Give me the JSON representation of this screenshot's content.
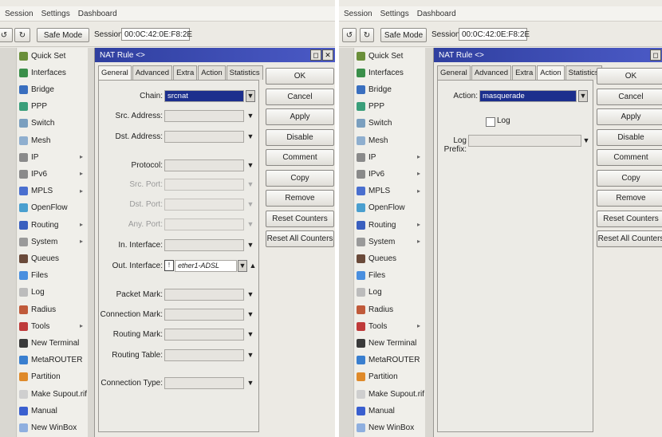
{
  "menubar": {
    "items": [
      "Session",
      "Settings",
      "Dashboard"
    ]
  },
  "toolbar": {
    "safe_mode": "Safe Mode",
    "session_label": "Session:",
    "session_value": "00:0C:42:0E:F8:2E"
  },
  "sidebar": {
    "items": [
      {
        "label": "Quick Set",
        "icon": "quick-set-icon",
        "color": "#6a8f3a",
        "submenu": false
      },
      {
        "label": "Interfaces",
        "icon": "interfaces-icon",
        "color": "#3a8f4a",
        "submenu": false
      },
      {
        "label": "Bridge",
        "icon": "bridge-icon",
        "color": "#3a6fbf",
        "submenu": false
      },
      {
        "label": "PPP",
        "icon": "ppp-icon",
        "color": "#3a9f7a",
        "submenu": false
      },
      {
        "label": "Switch",
        "icon": "switch-icon",
        "color": "#7a9fbf",
        "submenu": false
      },
      {
        "label": "Mesh",
        "icon": "mesh-icon",
        "color": "#8fafcf",
        "submenu": false
      },
      {
        "label": "IP",
        "icon": "ip-icon",
        "color": "#8a8a8a",
        "submenu": true
      },
      {
        "label": "IPv6",
        "icon": "ipv6-icon",
        "color": "#8a8a8a",
        "submenu": true
      },
      {
        "label": "MPLS",
        "icon": "mpls-icon",
        "color": "#4a6fcf",
        "submenu": true
      },
      {
        "label": "OpenFlow",
        "icon": "openflow-icon",
        "color": "#4a9fcf",
        "submenu": false
      },
      {
        "label": "Routing",
        "icon": "routing-icon",
        "color": "#3a5fbf",
        "submenu": true
      },
      {
        "label": "System",
        "icon": "system-icon",
        "color": "#9a9a9a",
        "submenu": true
      },
      {
        "label": "Queues",
        "icon": "queues-icon",
        "color": "#6a4a3a",
        "submenu": false
      },
      {
        "label": "Files",
        "icon": "files-icon",
        "color": "#4a8fdf",
        "submenu": false
      },
      {
        "label": "Log",
        "icon": "log-icon",
        "color": "#bcbcbc",
        "submenu": false
      },
      {
        "label": "Radius",
        "icon": "radius-icon",
        "color": "#c05a3a",
        "submenu": false
      },
      {
        "label": "Tools",
        "icon": "tools-icon",
        "color": "#bf3a3a",
        "submenu": true
      },
      {
        "label": "New Terminal",
        "icon": "terminal-icon",
        "color": "#3a3a3a",
        "submenu": false
      },
      {
        "label": "MetaROUTER",
        "icon": "metarouter-icon",
        "color": "#3a7fcf",
        "submenu": false
      },
      {
        "label": "Partition",
        "icon": "partition-icon",
        "color": "#df8a2a",
        "submenu": false
      },
      {
        "label": "Make Supout.rif",
        "icon": "supout-icon",
        "color": "#cfcfcf",
        "submenu": false
      },
      {
        "label": "Manual",
        "icon": "manual-icon",
        "color": "#3a5fcf",
        "submenu": false
      },
      {
        "label": "New WinBox",
        "icon": "winbox-icon",
        "color": "#8fafdf",
        "submenu": false
      }
    ]
  },
  "nat_window": {
    "title": "NAT Rule <>",
    "tabs": [
      "General",
      "Advanced",
      "Extra",
      "Action",
      "Statistics"
    ],
    "buttons": [
      "OK",
      "Cancel",
      "Apply",
      "Disable",
      "Comment",
      "Copy",
      "Remove",
      "Reset Counters",
      "Reset All Counters"
    ]
  },
  "left_form": {
    "chain_label": "Chain:",
    "chain_value": "srcnat",
    "src_address_label": "Src. Address:",
    "dst_address_label": "Dst. Address:",
    "protocol_label": "Protocol:",
    "src_port_label": "Src. Port:",
    "dst_port_label": "Dst. Port:",
    "any_port_label": "Any. Port:",
    "in_interface_label": "In. Interface:",
    "out_interface_label": "Out. Interface:",
    "out_interface_negate": "!",
    "out_interface_value": "ether1-ADSL",
    "packet_mark_label": "Packet Mark:",
    "connection_mark_label": "Connection Mark:",
    "routing_mark_label": "Routing Mark:",
    "routing_table_label": "Routing Table:",
    "connection_type_label": "Connection Type:"
  },
  "right_form": {
    "action_label": "Action:",
    "action_value": "masquerade",
    "log_label": "Log",
    "log_prefix_label": "Log Prefix:"
  }
}
